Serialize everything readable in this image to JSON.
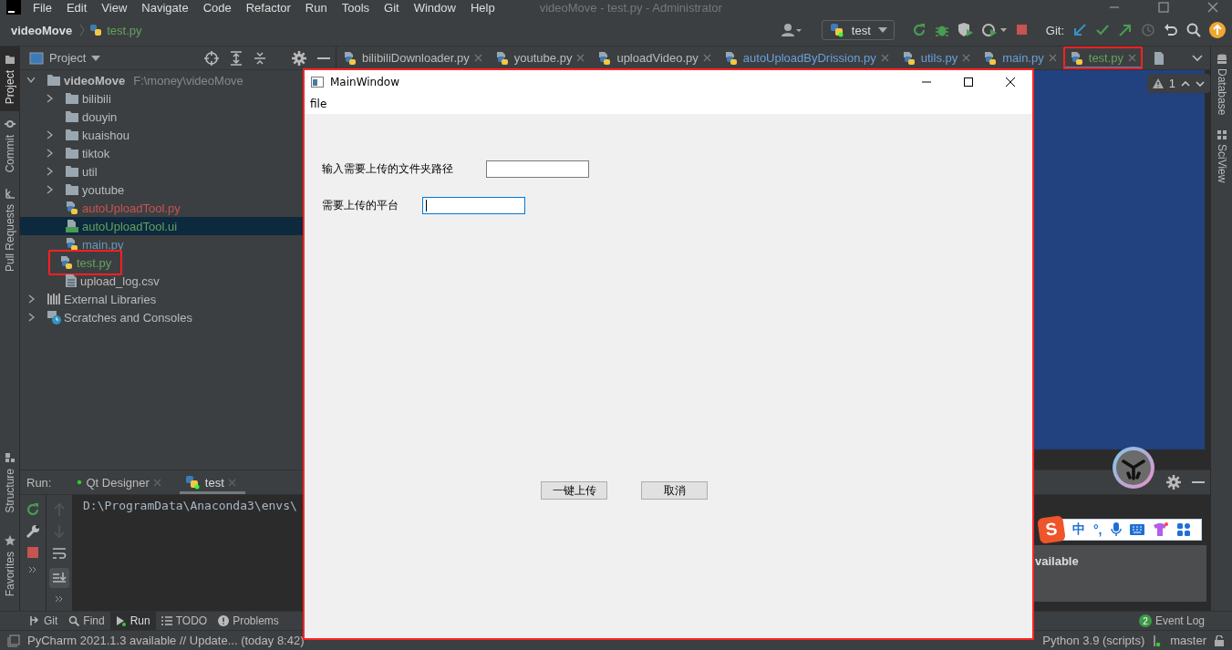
{
  "title_bar": {
    "menus": [
      "File",
      "Edit",
      "View",
      "Navigate",
      "Code",
      "Refactor",
      "Run",
      "Tools",
      "Git",
      "Window",
      "Help"
    ],
    "title": "videoMove - test.py - Administrator"
  },
  "nav_bar": {
    "breadcrumb": [
      {
        "label": "videoMove",
        "kind": "project"
      },
      {
        "label": "test.py",
        "kind": "python"
      }
    ],
    "run_config": "test",
    "git_label": "Git:"
  },
  "left_strip": [
    {
      "label": "Project",
      "kind": "project",
      "selected": true
    },
    {
      "label": "Commit",
      "kind": "commit",
      "selected": false
    },
    {
      "label": "Pull Requests",
      "kind": "pull",
      "selected": false
    }
  ],
  "left_strip_bottom": [
    {
      "label": "Structure",
      "kind": "structure"
    },
    {
      "label": "Favorites",
      "kind": "favorites"
    }
  ],
  "right_strip": [
    {
      "label": "Database",
      "kind": "database"
    },
    {
      "label": "SciView",
      "kind": "sciview"
    }
  ],
  "project_panel": {
    "title": "Project",
    "tree": [
      {
        "label": "videoMove",
        "path": "F:\\money\\videoMove",
        "kind": "folder",
        "expanded": true,
        "selected": false,
        "children": [
          {
            "label": "bilibili",
            "kind": "folder",
            "expanded": false,
            "selected": false
          },
          {
            "label": "douyin",
            "kind": "folder",
            "selected": false
          },
          {
            "label": "kuaishou",
            "kind": "folder",
            "expanded": false,
            "selected": false
          },
          {
            "label": "tiktok",
            "kind": "folder",
            "expanded": false,
            "selected": false
          },
          {
            "label": "util",
            "kind": "folder",
            "expanded": false,
            "selected": false
          },
          {
            "label": "youtube",
            "kind": "folder",
            "expanded": false,
            "selected": false
          },
          {
            "label": "autoUploadTool.py",
            "kind": "python",
            "color": "#c75450",
            "selected": false
          },
          {
            "label": "autoUploadTool.ui",
            "kind": "qt",
            "color": "#62a35c",
            "selected": true
          },
          {
            "label": "main.py",
            "kind": "python",
            "color": "#6897bb",
            "selected": false
          },
          {
            "label": "test.py",
            "kind": "python",
            "color": "#62a35c",
            "selected": false,
            "highlighted": true
          },
          {
            "label": "upload_log.csv",
            "kind": "csv",
            "selected": false
          }
        ]
      },
      {
        "label": "External Libraries",
        "kind": "library",
        "expanded": false,
        "selected": false
      },
      {
        "label": "Scratches and Consoles",
        "kind": "scratches",
        "expanded": false,
        "selected": false
      }
    ]
  },
  "editor": {
    "tabs": [
      {
        "label": "bilibiliDownloader.py",
        "color": "#bbbbbb",
        "selected": false
      },
      {
        "label": "youtube.py",
        "color": "#bbbbbb",
        "selected": false
      },
      {
        "label": "uploadVideo.py",
        "color": "#bbbbbb",
        "selected": false
      },
      {
        "label": "autoUploadByDrission.py",
        "color": "#6a9fd8",
        "selected": false
      },
      {
        "label": "utils.py",
        "color": "#6a9fd8",
        "selected": false
      },
      {
        "label": "main.py",
        "color": "#6a9fd8",
        "selected": false
      },
      {
        "label": "test.py",
        "color": "#62a35c",
        "selected": true,
        "highlighted": true
      }
    ],
    "warnings": "1"
  },
  "run_panel": {
    "label": "Run:",
    "tabs": [
      {
        "label": "Qt Designer",
        "kind": "qt",
        "selected": false
      },
      {
        "label": "test",
        "kind": "python",
        "selected": true
      }
    ],
    "console": "D:\\ProgramData\\Anaconda3\\envs\\"
  },
  "notification": {
    "text": "vailable"
  },
  "ime_toolbar": {
    "logo": "S",
    "mode": "中",
    "punctuation": "°,"
  },
  "tool_window_bar": [
    {
      "label": "Git",
      "kind": "git",
      "selected": false
    },
    {
      "label": "Find",
      "kind": "find",
      "selected": false
    },
    {
      "label": "Run",
      "kind": "run",
      "selected": true
    },
    {
      "label": "TODO",
      "kind": "todo",
      "selected": false
    },
    {
      "label": "Problems",
      "kind": "problems",
      "selected": false
    }
  ],
  "event_log": {
    "label": "Event Log",
    "count": "2"
  },
  "status_bar": {
    "message": "PyCharm 2021.1.3 available // Update... (today 8:42)",
    "interpreter": "Python 3.9 (scripts)",
    "branch": "master"
  },
  "main_window": {
    "title": "MainWindow",
    "menus": [
      "file"
    ],
    "fields": [
      {
        "label": "输入需要上传的文件夹路径",
        "focused": false
      },
      {
        "label": "需要上传的平台",
        "focused": true
      }
    ],
    "buttons": [
      "一键上传",
      "取消"
    ]
  }
}
